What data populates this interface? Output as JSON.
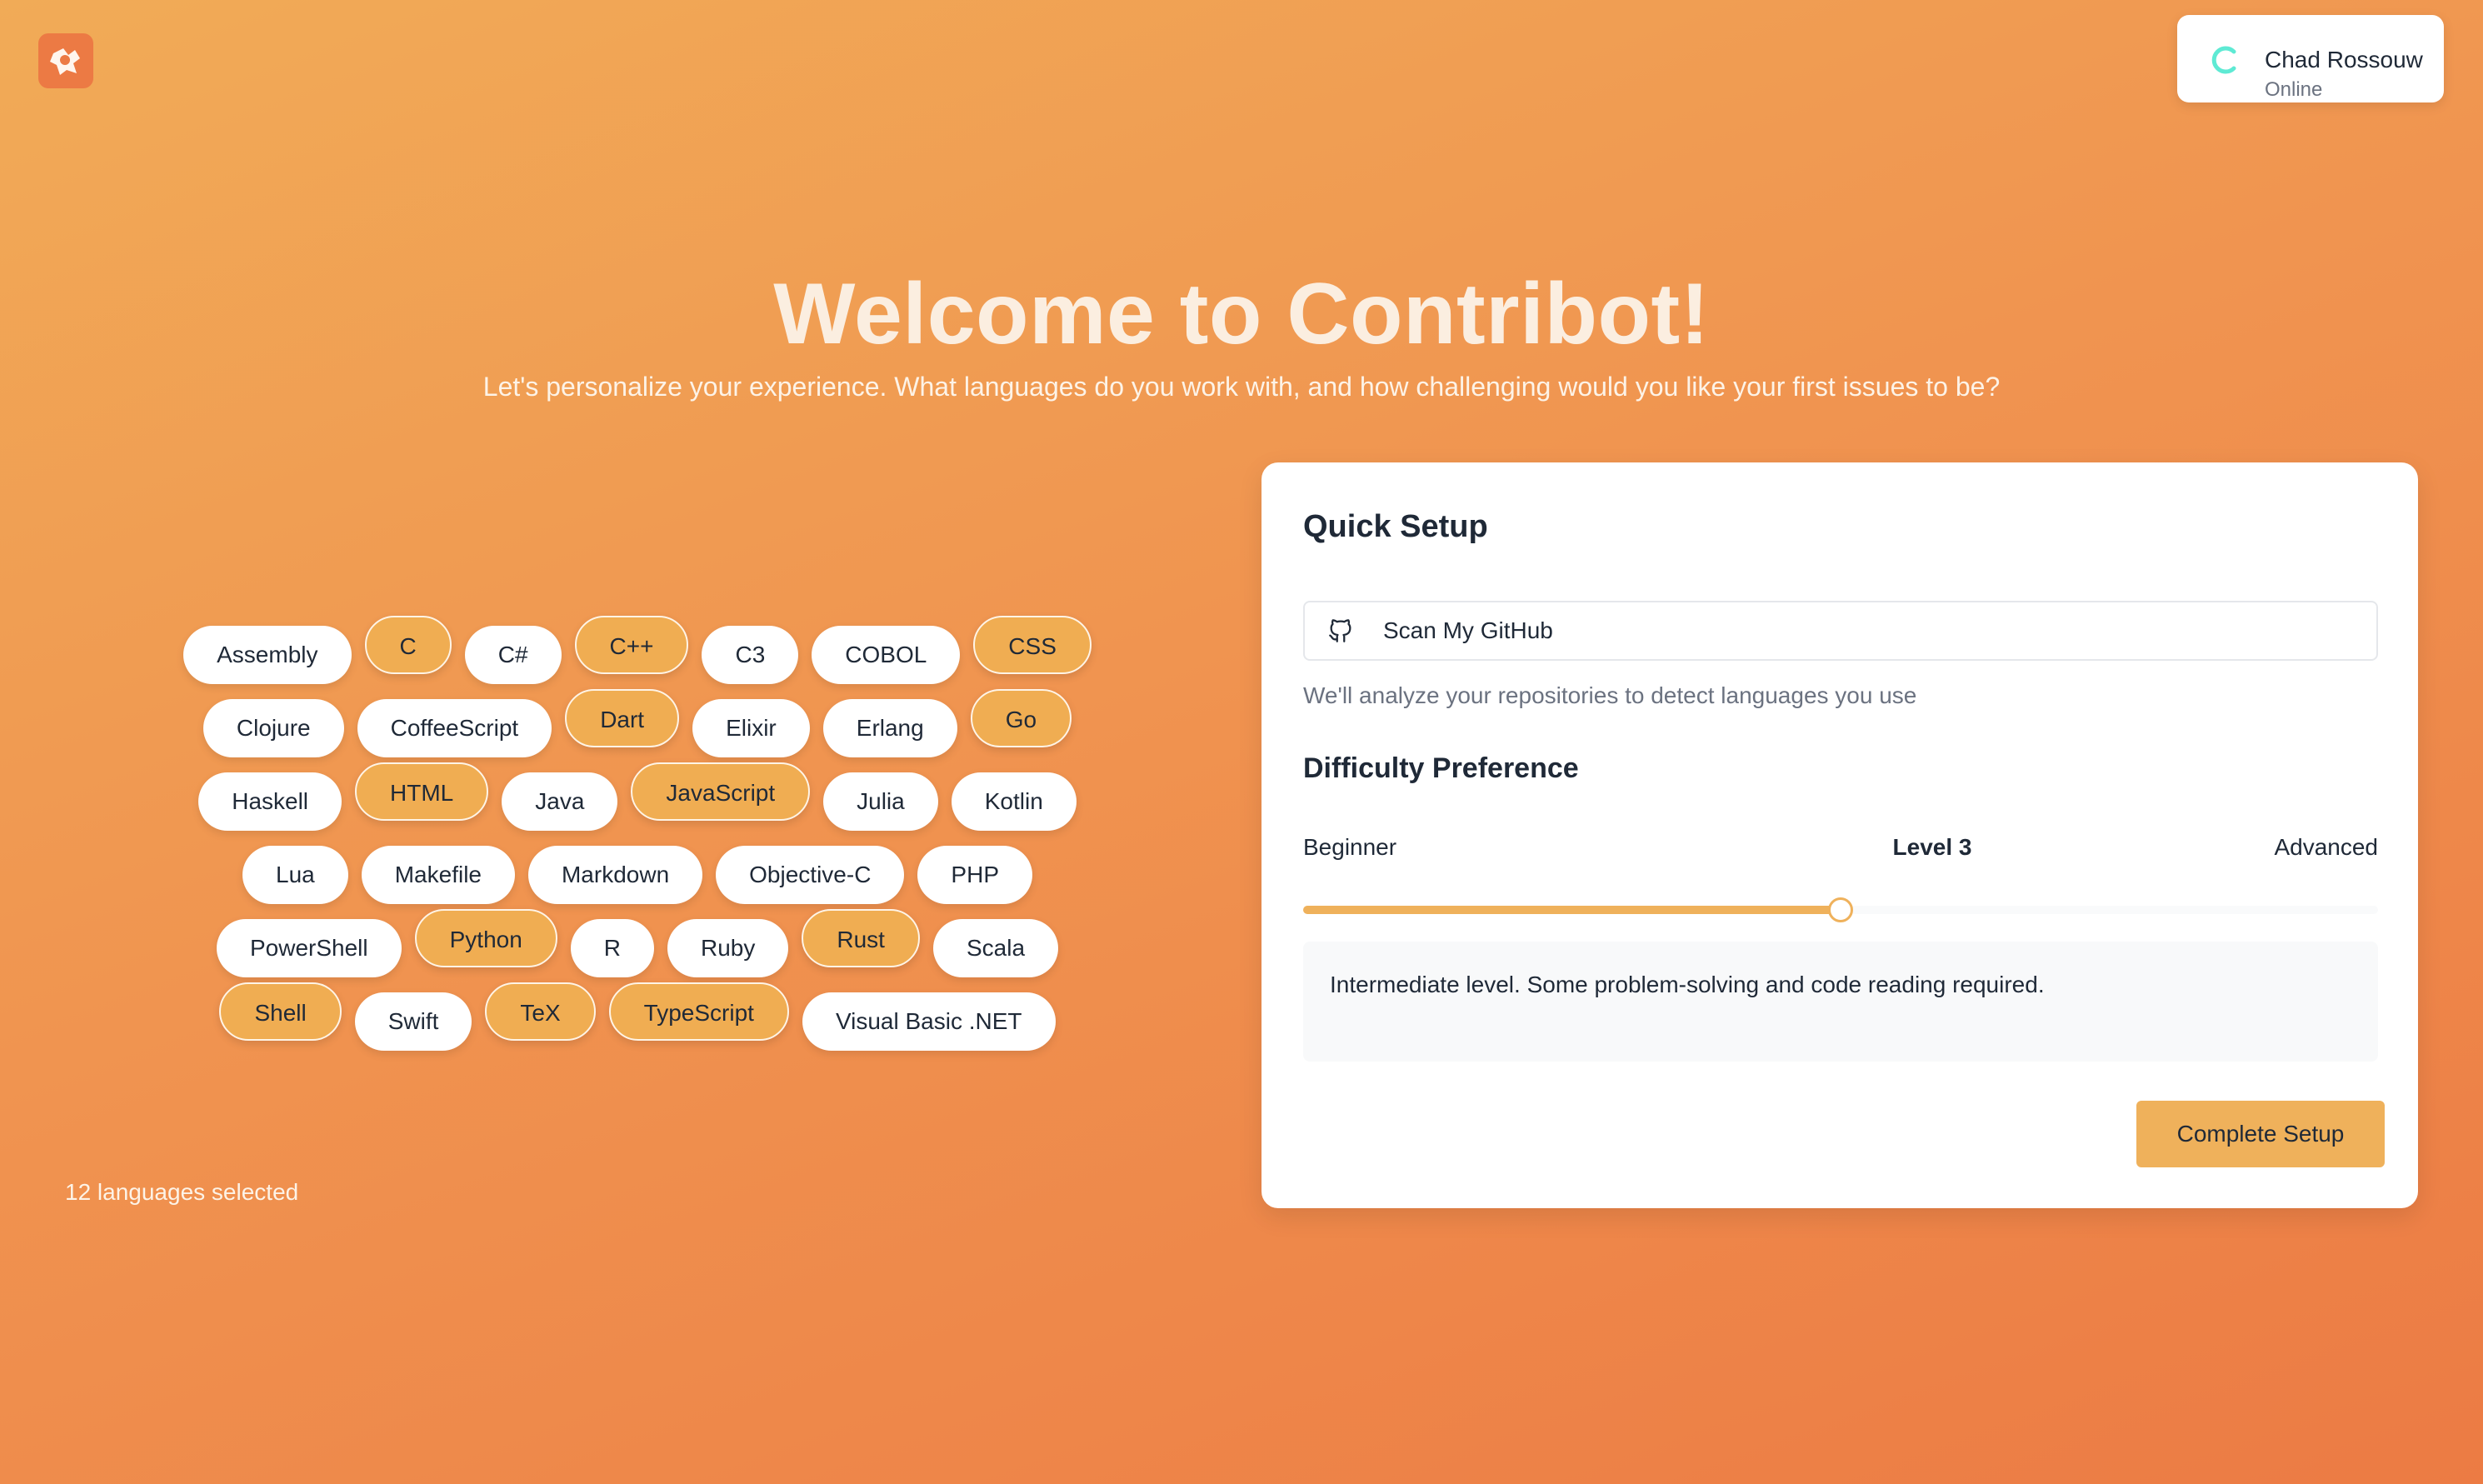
{
  "app": {
    "logo_icon": "contribot-logo-icon"
  },
  "user": {
    "name": "Chad Rossouw",
    "status": "Online",
    "avatar_icon": "loading-spinner-icon"
  },
  "hero": {
    "title": "Welcome to Contribot!",
    "subtitle": "Let's personalize your experience. What languages do you work with, and how challenging would you like your first issues to be?"
  },
  "languages": {
    "rows": [
      [
        {
          "label": "Assembly",
          "selected": false
        },
        {
          "label": "C",
          "selected": true
        },
        {
          "label": "C#",
          "selected": false
        },
        {
          "label": "C++",
          "selected": true
        },
        {
          "label": "C3",
          "selected": false
        },
        {
          "label": "COBOL",
          "selected": false
        },
        {
          "label": "CSS",
          "selected": true
        }
      ],
      [
        {
          "label": "Clojure",
          "selected": false
        },
        {
          "label": "CoffeeScript",
          "selected": false
        },
        {
          "label": "Dart",
          "selected": true
        },
        {
          "label": "Elixir",
          "selected": false
        },
        {
          "label": "Erlang",
          "selected": false
        },
        {
          "label": "Go",
          "selected": true
        }
      ],
      [
        {
          "label": "Haskell",
          "selected": false
        },
        {
          "label": "HTML",
          "selected": true
        },
        {
          "label": "Java",
          "selected": false
        },
        {
          "label": "JavaScript",
          "selected": true
        },
        {
          "label": "Julia",
          "selected": false
        },
        {
          "label": "Kotlin",
          "selected": false
        }
      ],
      [
        {
          "label": "Lua",
          "selected": false
        },
        {
          "label": "Makefile",
          "selected": false
        },
        {
          "label": "Markdown",
          "selected": false
        },
        {
          "label": "Objective-C",
          "selected": false
        },
        {
          "label": "PHP",
          "selected": false
        }
      ],
      [
        {
          "label": "PowerShell",
          "selected": false
        },
        {
          "label": "Python",
          "selected": true
        },
        {
          "label": "R",
          "selected": false
        },
        {
          "label": "Ruby",
          "selected": false
        },
        {
          "label": "Rust",
          "selected": true
        },
        {
          "label": "Scala",
          "selected": false
        }
      ],
      [
        {
          "label": "Shell",
          "selected": true
        },
        {
          "label": "Swift",
          "selected": false
        },
        {
          "label": "TeX",
          "selected": true
        },
        {
          "label": "TypeScript",
          "selected": true
        },
        {
          "label": "Visual Basic .NET",
          "selected": false
        }
      ]
    ],
    "selected_count_text": "12 languages selected"
  },
  "setup": {
    "title": "Quick Setup",
    "scan_button_label": "Scan My GitHub",
    "scan_icon": "github-icon",
    "scan_hint": "We'll analyze your repositories to detect languages you use",
    "difficulty_title": "Difficulty Preference",
    "min_label": "Beginner",
    "max_label": "Advanced",
    "level_label": "Level 3",
    "level_value": 3,
    "level_min": 1,
    "level_max": 5,
    "description": "Intermediate level. Some problem-solving and code reading required.",
    "complete_button_label": "Complete Setup"
  },
  "colors": {
    "accent": "#efb15b",
    "selected_chip": "#f0ad52",
    "background_start": "#f1ab57",
    "background_end": "#ec7b44",
    "spinner": "#5eead4"
  }
}
